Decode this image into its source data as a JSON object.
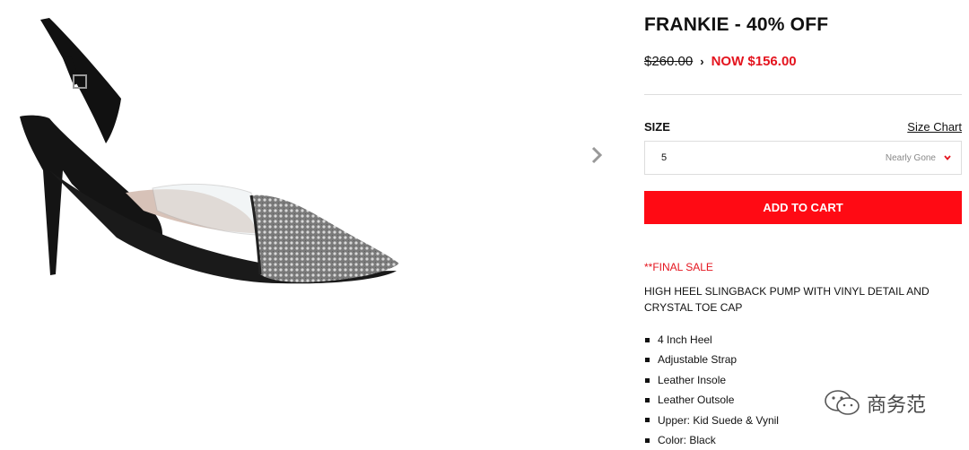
{
  "product": {
    "title": "FRANKIE - 40% OFF",
    "old_price": "$260.00",
    "now_price": "NOW $156.00"
  },
  "size": {
    "label": "SIZE",
    "chart_link": "Size Chart",
    "selected": "5",
    "status": "Nearly Gone"
  },
  "cart": {
    "button_label": "ADD TO CART"
  },
  "info": {
    "final_sale": "**FINAL SALE",
    "description": "HIGH HEEL SLINGBACK PUMP WITH VINYL DETAIL AND CRYSTAL TOE CAP",
    "features": [
      "4 Inch Heel",
      "Adjustable Strap",
      "Leather Insole",
      "Leather Outsole",
      "Upper: Kid Suede & Vynil",
      "Color: Black"
    ]
  },
  "watermark": {
    "text": "商务范"
  },
  "colors": {
    "accent": "#ff0a14",
    "sale_text": "#e4141e"
  }
}
